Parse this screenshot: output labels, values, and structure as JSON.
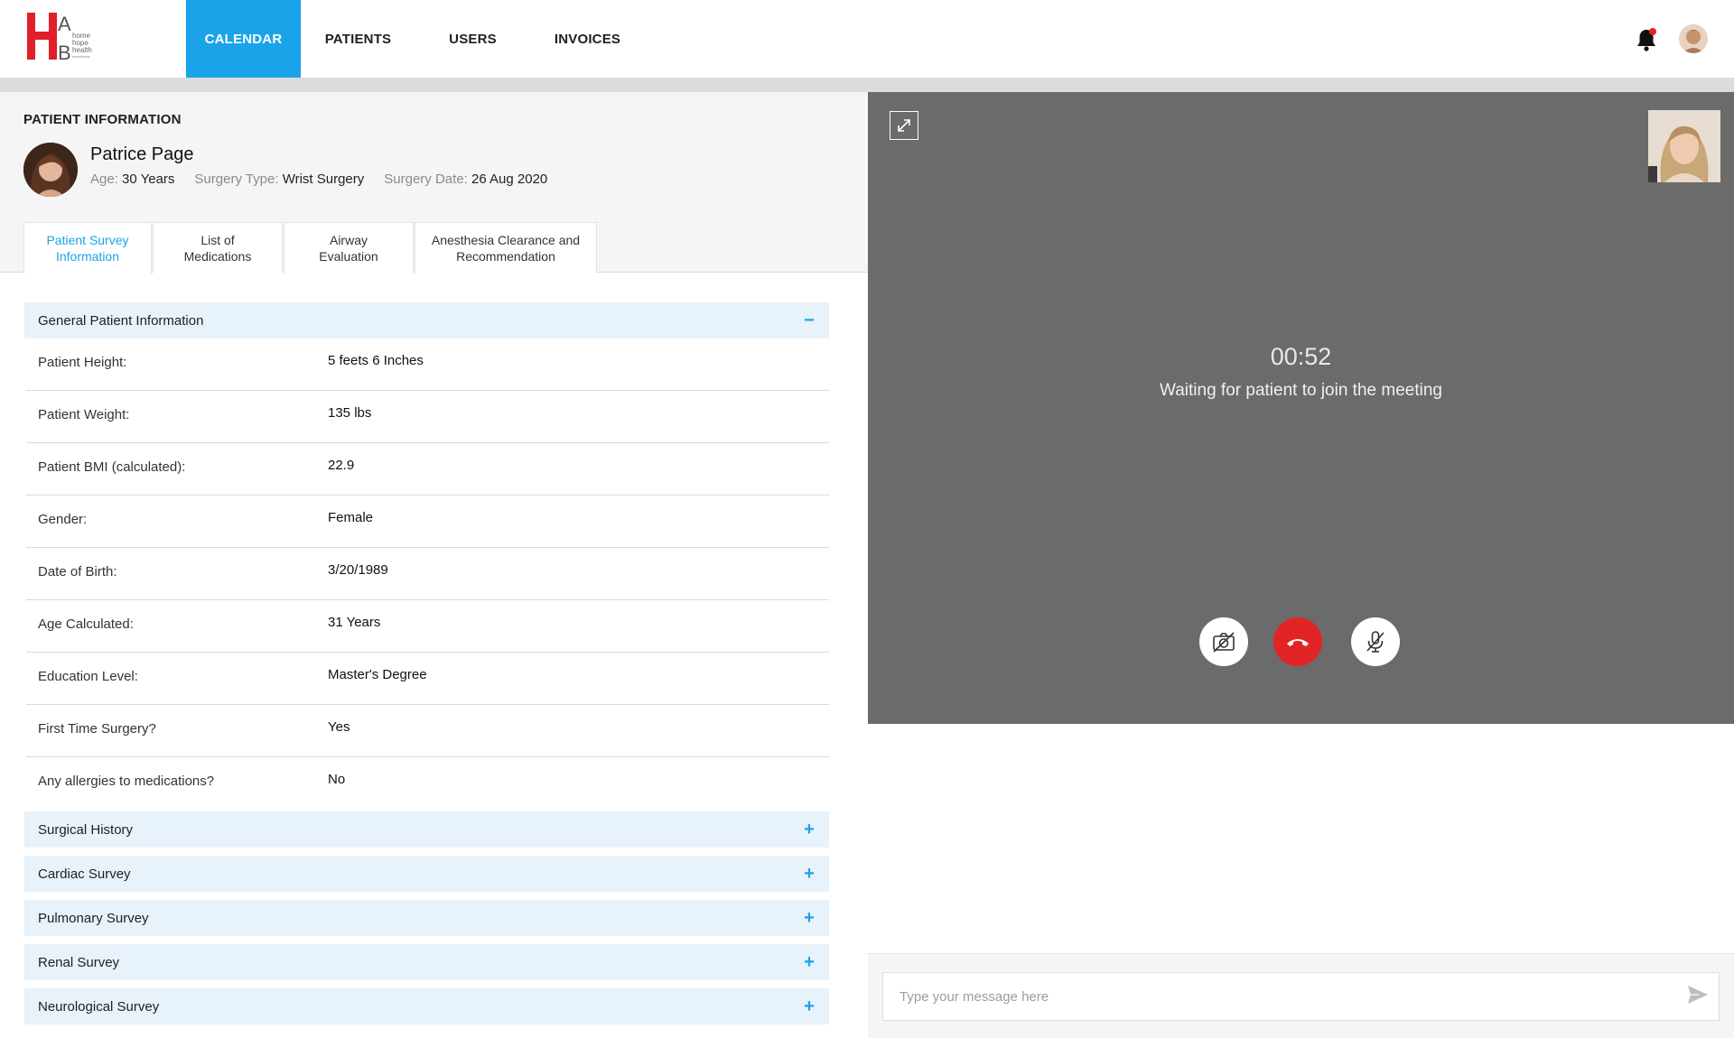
{
  "header": {
    "logo_text": [
      "home",
      "hope",
      "health",
      "anesthesia"
    ],
    "nav": [
      {
        "label": "CALENDAR",
        "active": true
      },
      {
        "label": "PATIENTS",
        "active": false
      },
      {
        "label": "USERS",
        "active": false
      },
      {
        "label": "INVOICES",
        "active": false
      }
    ],
    "icons": {
      "notifications": "bell-icon",
      "account": "user-avatar"
    },
    "colors": {
      "accent": "#1aa3e8",
      "logo_red": "#e01f2a",
      "end_call": "#e32424"
    }
  },
  "patient": {
    "section_title": "PATIENT INFORMATION",
    "name": "Patrice Page",
    "age_label": "Age:",
    "age_value": "30 Years",
    "surgery_type_label": "Surgery Type:",
    "surgery_type_value": "Wrist Surgery",
    "surgery_date_label": "Surgery Date:",
    "surgery_date_value": "26 Aug 2020"
  },
  "tabs": [
    {
      "line1": "Patient Survey",
      "line2": "Information",
      "active": true
    },
    {
      "line1": "List of",
      "line2": "Medications",
      "active": false
    },
    {
      "line1": "Airway",
      "line2": "Evaluation",
      "active": false
    },
    {
      "line1": "Anesthesia Clearance and",
      "line2": "Recommendation",
      "active": false
    }
  ],
  "general_section": {
    "title": "General Patient Information",
    "toggle": "−",
    "rows": [
      {
        "label": "Patient Height:",
        "value": "5 feets 6 Inches"
      },
      {
        "label": "Patient Weight:",
        "value": "135 lbs"
      },
      {
        "label": "Patient BMI (calculated):",
        "value": "22.9"
      },
      {
        "label": "Gender:",
        "value": "Female"
      },
      {
        "label": "Date of Birth:",
        "value": "3/20/1989"
      },
      {
        "label": "Age Calculated:",
        "value": "31 Years"
      },
      {
        "label": "Education Level:",
        "value": "Master's Degree"
      },
      {
        "label": "First Time Surgery?",
        "value": "Yes"
      },
      {
        "label": "Any allergies to medications?",
        "value": "No"
      }
    ]
  },
  "collapsed_sections": [
    {
      "title": "Surgical History",
      "toggle": "+"
    },
    {
      "title": "Cardiac Survey",
      "toggle": "+"
    },
    {
      "title": "Pulmonary Survey",
      "toggle": "+"
    },
    {
      "title": "Renal Survey",
      "toggle": "+"
    },
    {
      "title": "Neurological Survey",
      "toggle": "+"
    }
  ],
  "video": {
    "timer": "00:52",
    "status": "Waiting for patient to join the meeting",
    "controls": [
      "camera-off-icon",
      "end-call-icon",
      "mic-off-icon"
    ]
  },
  "chat": {
    "placeholder": "Type your message here"
  }
}
